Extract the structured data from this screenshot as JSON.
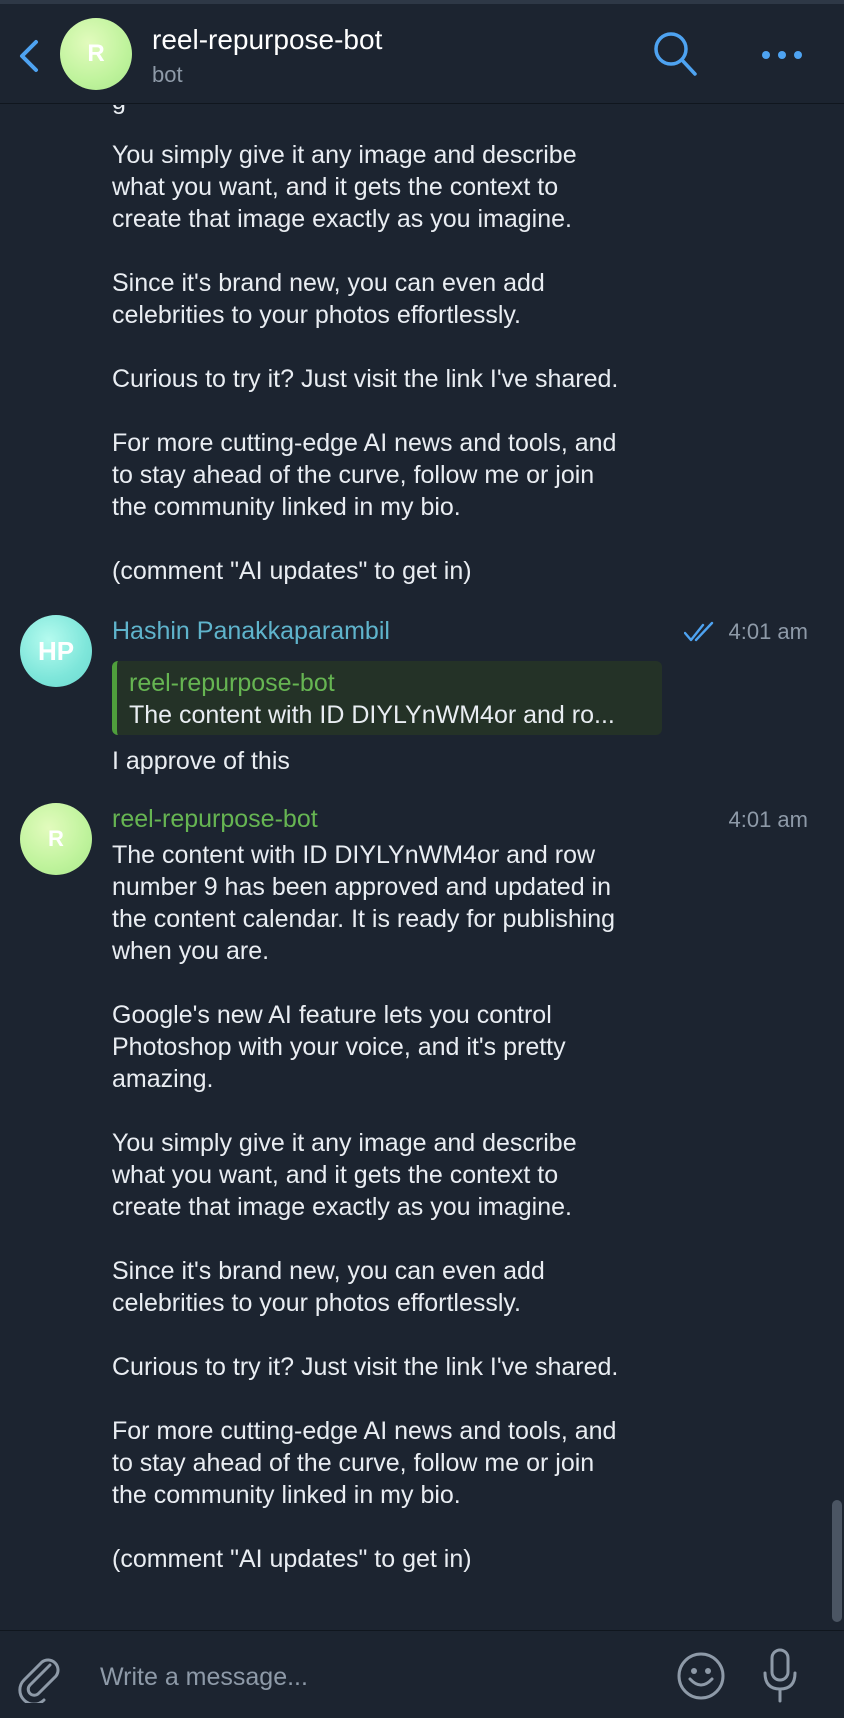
{
  "header": {
    "title": "reel-repurpose-bot",
    "subtitle": "bot",
    "avatar_initial": "R"
  },
  "messages": {
    "top_partial_lines": [
      "You simply give it any image and describe\nwhat you want, and it gets the context to\ncreate that image exactly as you imagine.",
      "Since it's brand new, you can even add\ncelebrities to your photos effortlessly.",
      "Curious to try it? Just visit the link I've shared.",
      "For more cutting-edge AI news and tools, and\nto stay ahead of the curve, follow me or join\nthe community linked in my bio.",
      "(comment \"AI updates\" to get in)"
    ],
    "user_message": {
      "sender": "Hashin Panakkaparambil",
      "avatar_initials": "HP",
      "time": "4:01 am",
      "reply_name": "reel-repurpose-bot",
      "reply_text": "The content with ID DIYLYnWM4or and ro...",
      "text": "I approve of this"
    },
    "bot_message": {
      "sender": "reel-repurpose-bot",
      "avatar_initial": "R",
      "time": "4:01 am",
      "paragraphs": [
        "The content with ID DIYLYnWM4or and row\nnumber 9 has been approved and updated in\nthe content calendar. It is ready for publishing\nwhen you are.",
        "Google's new AI feature lets you control\nPhotoshop with your voice, and it's pretty\namazing.",
        "You simply give it any image and describe\nwhat you want, and it gets the context to\ncreate that image exactly as you imagine.",
        "Since it's brand new, you can even add\ncelebrities to your photos effortlessly.",
        "Curious to try it? Just visit the link I've shared.",
        "For more cutting-edge AI news and tools, and\nto stay ahead of the curve, follow me or join\nthe community linked in my bio.",
        "(comment \"AI updates\" to get in)"
      ]
    }
  },
  "composer": {
    "placeholder": "Write a message..."
  },
  "colors": {
    "background": "#1c2430",
    "accent": "#4ea3f1",
    "bot_name": "#66b552",
    "user_name": "#5fb4cc"
  }
}
